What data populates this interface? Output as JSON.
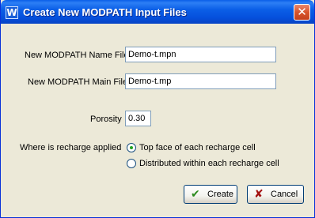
{
  "window": {
    "title": "Create New MODPATH Input Files",
    "app_icon_letter": "W",
    "close_glyph": "✕"
  },
  "form": {
    "name_file": {
      "label": "New MODPATH Name File",
      "value": "Demo-t.mpn"
    },
    "main_file": {
      "label": "New MODPATH Main File",
      "value": "Demo-t.mp"
    },
    "porosity": {
      "label": "Porosity",
      "value": "0.30"
    },
    "recharge": {
      "label": "Where is recharge applied",
      "options": [
        {
          "label": "Top face of each recharge cell",
          "selected": true
        },
        {
          "label": "Distributed within each recharge cell",
          "selected": false
        }
      ]
    }
  },
  "buttons": {
    "create": {
      "label": "Create",
      "icon": "check-icon",
      "glyph": "✔",
      "color": "#2b8a1e"
    },
    "cancel": {
      "label": "Cancel",
      "icon": "x-icon",
      "glyph": "✘",
      "color": "#a31212"
    }
  }
}
